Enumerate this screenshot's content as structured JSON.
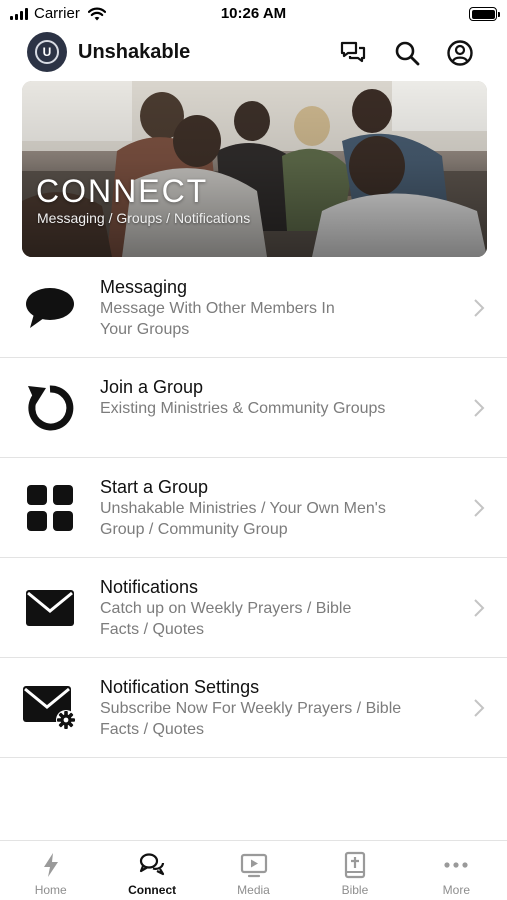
{
  "status_bar": {
    "carrier": "Carrier",
    "time": "10:26 AM"
  },
  "header": {
    "app_title": "Unshakable",
    "avatar_letter": "U"
  },
  "banner": {
    "title": "CONNECT",
    "subtitle": "Messaging / Groups / Notifications"
  },
  "menu": [
    {
      "title": "Messaging",
      "desc_line1": "Message With Other Members In",
      "desc_line2": "Your Groups",
      "icon": "speech-bubble-icon"
    },
    {
      "title": "Join a Group",
      "desc_line1": "Existing Ministries & Community Groups",
      "desc_line2": "",
      "icon": "refresh-arrow-icon"
    },
    {
      "title": "Start a Group",
      "desc_line1": "Unshakable Ministries / Your Own Men's",
      "desc_line2": "Group / Community Group",
      "icon": "grid-icon"
    },
    {
      "title": "Notifications",
      "desc_line1": "Catch up on Weekly Prayers / Bible",
      "desc_line2": "Facts / Quotes",
      "icon": "envelope-icon"
    },
    {
      "title": "Notification Settings",
      "desc_line1": "Subscribe Now For Weekly Prayers / Bible",
      "desc_line2": "Facts / Quotes",
      "icon": "envelope-gear-icon"
    }
  ],
  "tabs": [
    {
      "label": "Home",
      "icon": "lightning-icon",
      "active": false
    },
    {
      "label": "Connect",
      "icon": "chat-bubbles-icon",
      "active": true
    },
    {
      "label": "Media",
      "icon": "play-screen-icon",
      "active": false
    },
    {
      "label": "Bible",
      "icon": "bible-icon",
      "active": false
    },
    {
      "label": "More",
      "icon": "more-dots-icon",
      "active": false
    }
  ],
  "colors": {
    "text": "#111111",
    "secondary_text": "#7c7c7c",
    "divider": "#e3e3e3",
    "inactive_tab": "#8e8e8e",
    "avatar_bg": "#2c3345"
  }
}
